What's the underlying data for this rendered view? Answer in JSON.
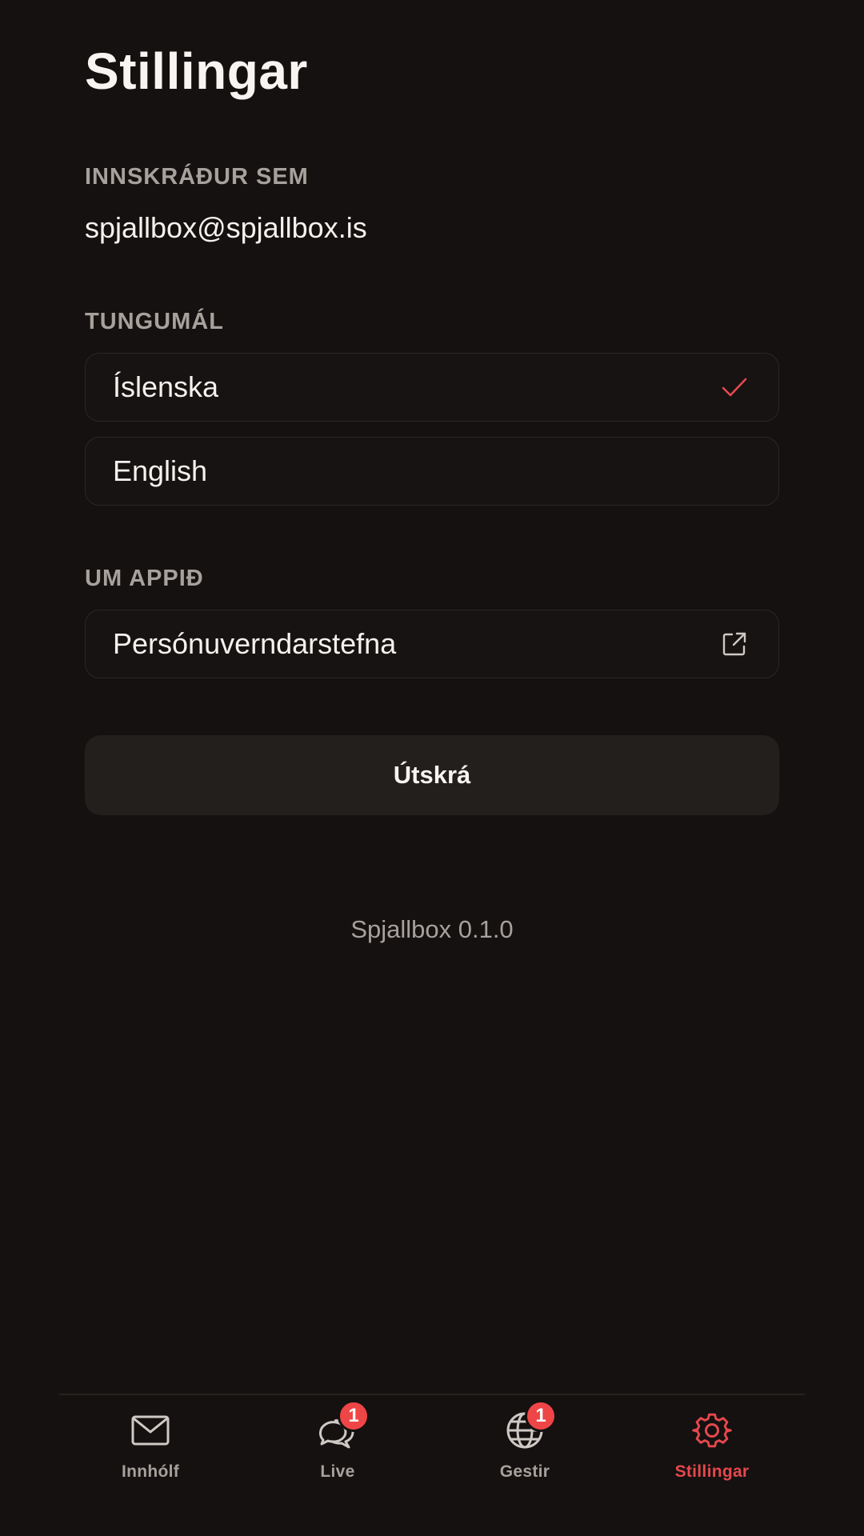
{
  "header": {
    "title": "Stillingar"
  },
  "account": {
    "section_label": "INNSKRÁÐUR SEM",
    "email": "spjallbox@spjallbox.is"
  },
  "language": {
    "section_label": "TUNGUMÁL",
    "options": [
      {
        "label": "Íslenska",
        "selected": true
      },
      {
        "label": "English",
        "selected": false
      }
    ]
  },
  "about": {
    "section_label": "UM APPIÐ",
    "items": [
      {
        "label": "Persónuverndarstefna",
        "icon": "external-link-icon"
      }
    ]
  },
  "logout": {
    "label": "Útskrá"
  },
  "version": {
    "text": "Spjallbox 0.1.0"
  },
  "tabbar": {
    "tabs": [
      {
        "label": "Innhólf",
        "icon": "mail-icon",
        "badge": null,
        "active": false
      },
      {
        "label": "Live",
        "icon": "chat-bubbles-icon",
        "badge": "1",
        "active": false
      },
      {
        "label": "Gestir",
        "icon": "globe-icon",
        "badge": "1",
        "active": false
      },
      {
        "label": "Stillingar",
        "icon": "gear-icon",
        "badge": null,
        "active": true
      }
    ]
  },
  "colors": {
    "accent": "#e5484d",
    "background": "#141110",
    "badge": "#ee4546"
  }
}
